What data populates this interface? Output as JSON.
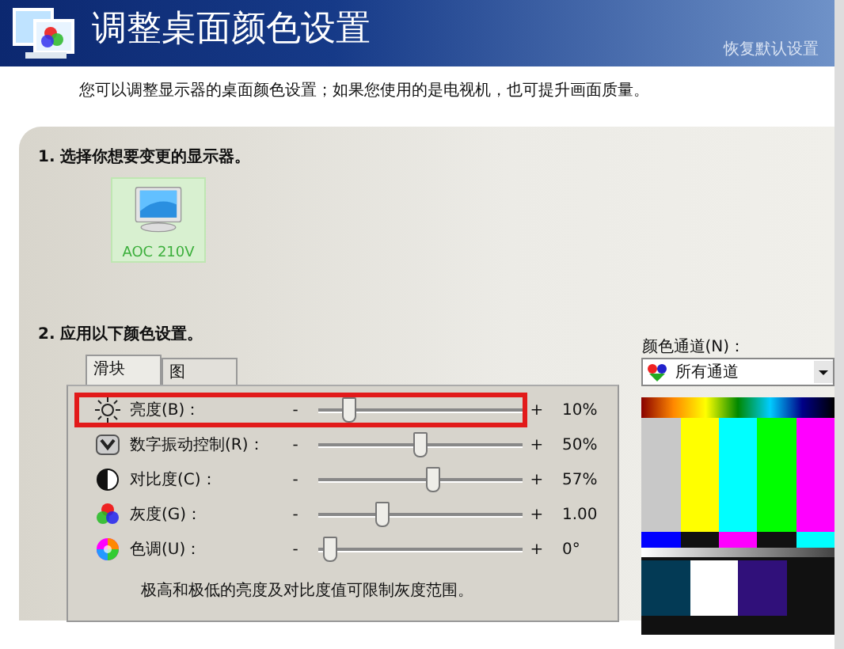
{
  "header": {
    "title": "调整桌面颜色设置",
    "restore_link": "恢复默认设置"
  },
  "description": "您可以调整显示器的桌面颜色设置；如果您使用的是电视机，也可提升画面质量。",
  "step1": {
    "heading": "1.  选择你想要变更的显示器。",
    "displays": [
      {
        "name": "AOC 210V",
        "selected": true
      }
    ]
  },
  "step2": {
    "heading": "2.  应用以下颜色设置。",
    "tabs": [
      {
        "label": "滑块",
        "selected": true
      },
      {
        "label": "图",
        "selected": false
      }
    ],
    "sliders": [
      {
        "kind": "sun",
        "label": "亮度(B)：",
        "minus": "-",
        "plus": "+",
        "level": 0.13,
        "reading": "10%",
        "highlighted": true
      },
      {
        "kind": "vibrance",
        "label": "数字振动控制(R)：",
        "minus": "-",
        "plus": "+",
        "level": 0.5,
        "reading": "50%",
        "highlighted": false
      },
      {
        "kind": "contrast",
        "label": "对比度(C)：",
        "minus": "-",
        "plus": "+",
        "level": 0.57,
        "reading": "57%",
        "highlighted": false
      },
      {
        "kind": "gamma",
        "label": "灰度(G)：",
        "minus": "-",
        "plus": "+",
        "level": 0.3,
        "reading": "1.00",
        "highlighted": false
      },
      {
        "kind": "hue",
        "label": "色调(U)：",
        "minus": "-",
        "plus": "+",
        "level": 0.03,
        "reading": "0°",
        "highlighted": false
      }
    ],
    "note": "极高和极低的亮度及对比度值可限制灰度范围。",
    "channel": {
      "label": "颜色通道(N)：",
      "value": "所有通道"
    }
  }
}
